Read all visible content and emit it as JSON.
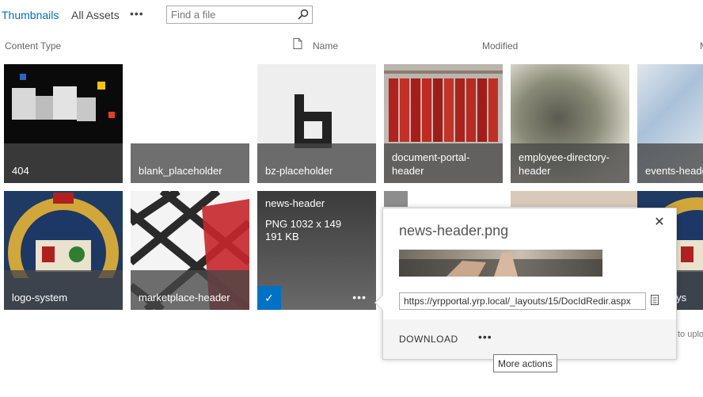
{
  "views": {
    "active_label": "Thumbnails",
    "all_label": "All Assets",
    "more_label": "•••"
  },
  "search": {
    "placeholder": "Find a file"
  },
  "columns": {
    "content_type": "Content Type",
    "name": "Name",
    "modified": "Modified",
    "overflow": "M"
  },
  "tiles": [
    {
      "label": "404"
    },
    {
      "label": "blank_placeholder"
    },
    {
      "label": "bz-placeholder"
    },
    {
      "label": "document-portal-header"
    },
    {
      "label": "employee-directory-header"
    },
    {
      "label": "events-heade"
    },
    {
      "label": "logo-system"
    },
    {
      "label": "marketplace-header"
    },
    {
      "label": "news-header",
      "format_dims": "PNG 1032 x 149",
      "size": "191 KB"
    },
    {
      "label": "celogo-sys"
    }
  ],
  "news_tile": {
    "check": "✓",
    "dots": "•••"
  },
  "callout": {
    "title": "news-header.png",
    "close": "✕",
    "url": "https://yrpportal.yrp.local/_layouts/15/DocIdRedir.aspx",
    "download_label": "DOWNLOAD",
    "more_label": "•••"
  },
  "tooltip": "More actions",
  "background_text": "to uplo",
  "colors": {
    "accent": "#0072c6",
    "label_overlay": "#464646"
  }
}
